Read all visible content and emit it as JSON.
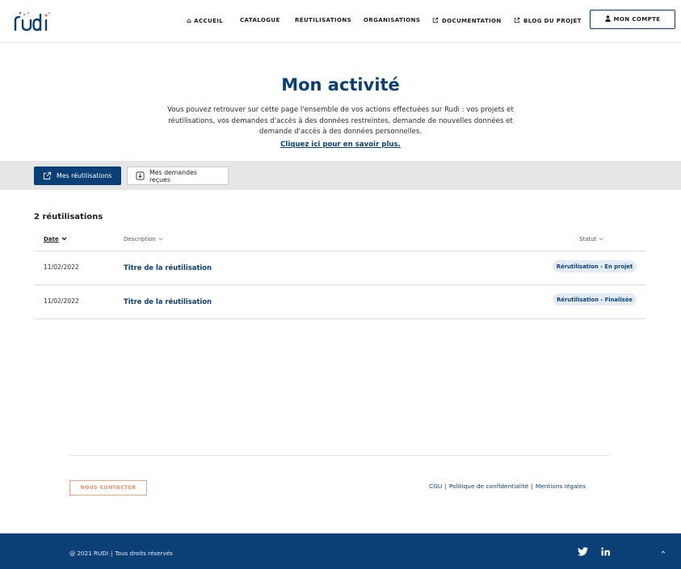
{
  "header": {
    "logo_text": "rudi",
    "nav": [
      {
        "label": "ACCUEIL",
        "icon": "home-icon"
      },
      {
        "label": "CATALOGUE"
      },
      {
        "label": "RÉUTILISATIONS"
      },
      {
        "label": "ORGANISATIONS"
      },
      {
        "label": "DOCUMENTATION",
        "icon": "external-link-icon"
      },
      {
        "label": "BLOG DU PROJET",
        "icon": "external-link-icon"
      }
    ],
    "account_label": "MON COMPTE"
  },
  "intro": {
    "title": "Mon activité",
    "text": "Vous pouvez retrouver sur cette page l'ensemble de vos actions effectuées sur Rudi : vos projets et réutilisations, vos demandes d'accès à des données restreintes, demande de nouvelles données et demande d'accès à des données personnelles.",
    "link": "Cliquez ici pour en savoir plus."
  },
  "tabs": [
    {
      "label": "Mes réutilisations",
      "active": true,
      "icon": "external-link-icon"
    },
    {
      "label": "Mes demandes reçues",
      "active": false,
      "icon": "download-box-icon"
    }
  ],
  "table": {
    "count_label": "2 réutilisations",
    "columns": {
      "date": "Date",
      "description": "Description",
      "status": "Statut"
    },
    "rows": [
      {
        "date": "11/02/2022",
        "title": "Titre de la réutilisation",
        "status": "Rérutilisation - En projet"
      },
      {
        "date": "11/02/2022",
        "title": "Titre de la réutilisation",
        "status": "Rérutilisation - Finalisée"
      }
    ]
  },
  "footer": {
    "contact_label": "NOUS CONTACTER",
    "legal_links": [
      "CGU",
      "Politique de confidentialité",
      "Mentions légales"
    ],
    "copyright": "@ 2021 RUDI",
    "rights": "Tous droits réservés",
    "social": [
      "twitter-icon",
      "linkedin-icon"
    ]
  },
  "colors": {
    "brand": "#0b4077",
    "accent": "#f08a66",
    "badge_bg": "#e3ecf6",
    "band_bg": "#e6e6e6"
  }
}
